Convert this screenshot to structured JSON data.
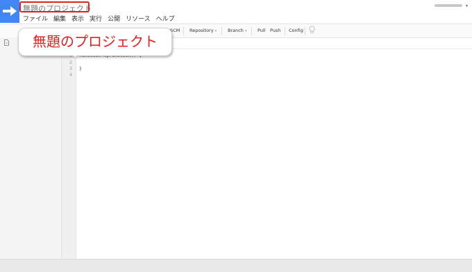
{
  "app": {
    "title": "無題のプロジェクト",
    "account_arrow": "▾",
    "accent_color": "#4285f4"
  },
  "menu": [
    "ファイル",
    "編集",
    "表示",
    "実行",
    "公開",
    "リソース",
    "ヘルプ"
  ],
  "toolbar": {
    "scm": "SCM",
    "repository": "Repository",
    "branch": "Branch",
    "pull": "Pull",
    "push": "Push",
    "config": "Config",
    "dropdown": "▾"
  },
  "editor": {
    "line_numbers": [
      "1",
      "2",
      "3",
      "4"
    ],
    "lines": [
      "function myFunction() {",
      "",
      "}",
      ""
    ]
  },
  "callout": {
    "text": "無題のプロジェクト",
    "color": "#e02020"
  }
}
